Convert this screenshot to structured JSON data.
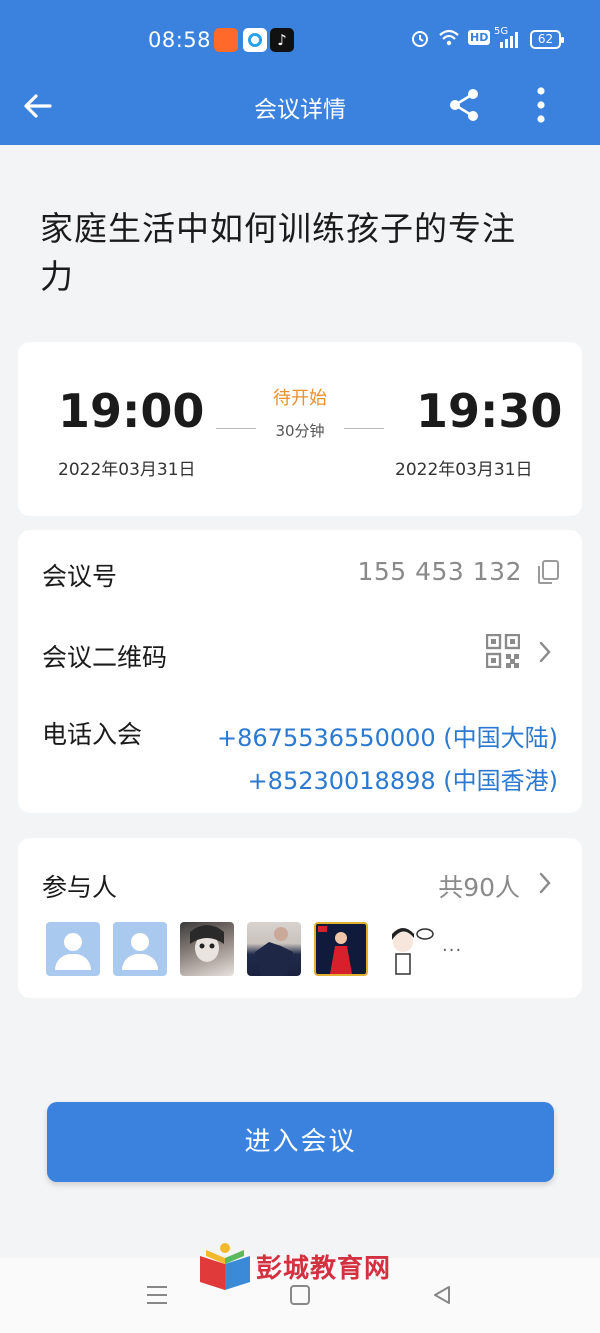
{
  "status_bar": {
    "time": "08:58",
    "battery": "62",
    "network": "5G",
    "hd": "HD"
  },
  "app_bar": {
    "title": "会议详情"
  },
  "meeting": {
    "title": "家庭生活中如何训练孩子的专注力",
    "start_time": "19:00",
    "start_date": "2022年03月31日",
    "end_time": "19:30",
    "end_date": "2022年03月31日",
    "status": "待开始",
    "duration": "30分钟"
  },
  "info": {
    "id_label": "会议号",
    "id_value": "155 453 132",
    "qr_label": "会议二维码",
    "phone_label": "电话入会",
    "phones": [
      "+8675536550000 (中国大陆)",
      "+85230018898 (中国香港)"
    ]
  },
  "participants": {
    "label": "参与人",
    "count": "共90人",
    "more": "···"
  },
  "join_button": "进入会议",
  "watermark": "彭城教育网",
  "colors": {
    "primary": "#3a82de",
    "status_orange": "#e8912f",
    "link_blue": "#2b79d1"
  }
}
